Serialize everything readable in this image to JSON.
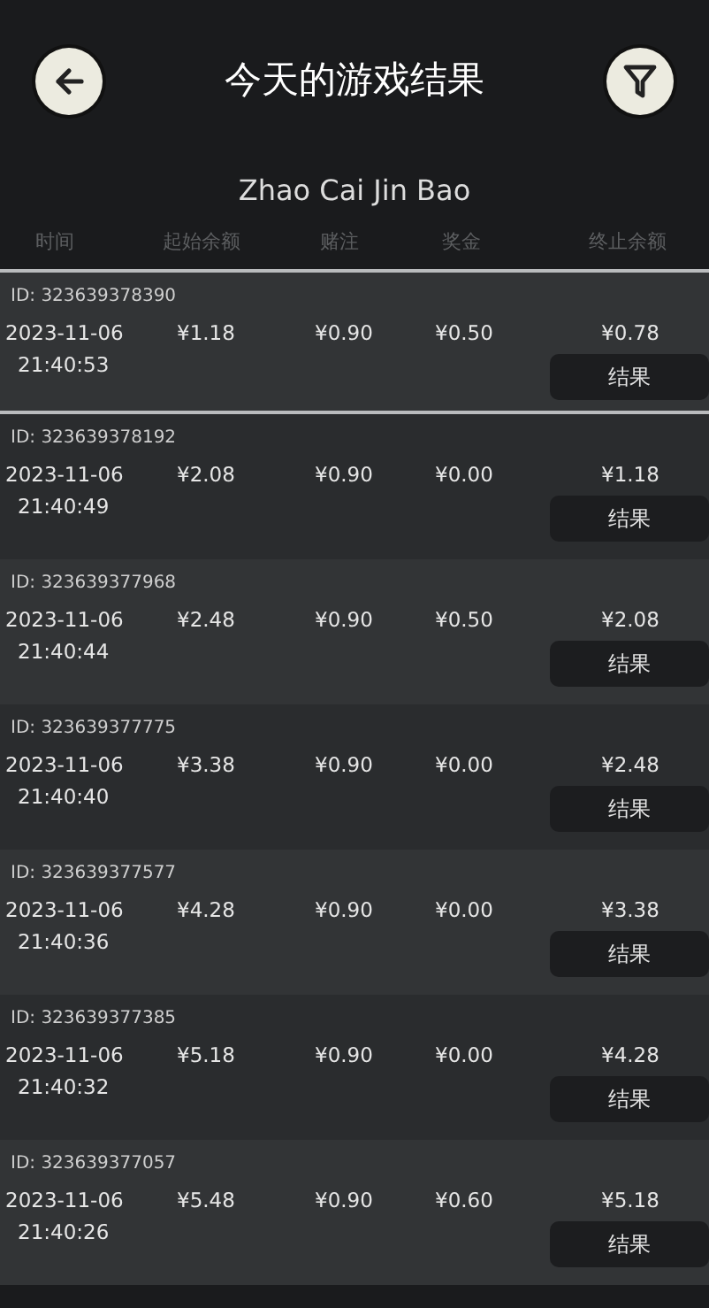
{
  "header": {
    "title": "今天的游戏结果"
  },
  "game_name": "Zhao Cai Jin Bao",
  "columns": [
    "时间",
    "起始余额",
    "赌注",
    "奖金",
    "终止余额"
  ],
  "rows": [
    {
      "id_label": "ID:",
      "id": "323639378390",
      "date": "2023-11-06",
      "time": "21:40:53",
      "start": "¥1.18",
      "bet": "¥0.90",
      "win": "¥0.50",
      "end": "¥0.78",
      "button": "结果",
      "selected": true
    },
    {
      "id_label": "ID:",
      "id": "323639378192",
      "date": "2023-11-06",
      "time": "21:40:49",
      "start": "¥2.08",
      "bet": "¥0.90",
      "win": "¥0.00",
      "end": "¥1.18",
      "button": "结果",
      "selected": false
    },
    {
      "id_label": "ID:",
      "id": "323639377968",
      "date": "2023-11-06",
      "time": "21:40:44",
      "start": "¥2.48",
      "bet": "¥0.90",
      "win": "¥0.50",
      "end": "¥2.08",
      "button": "结果",
      "selected": false
    },
    {
      "id_label": "ID:",
      "id": "323639377775",
      "date": "2023-11-06",
      "time": "21:40:40",
      "start": "¥3.38",
      "bet": "¥0.90",
      "win": "¥0.00",
      "end": "¥2.48",
      "button": "结果",
      "selected": false
    },
    {
      "id_label": "ID:",
      "id": "323639377577",
      "date": "2023-11-06",
      "time": "21:40:36",
      "start": "¥4.28",
      "bet": "¥0.90",
      "win": "¥0.00",
      "end": "¥3.38",
      "button": "结果",
      "selected": false
    },
    {
      "id_label": "ID:",
      "id": "323639377385",
      "date": "2023-11-06",
      "time": "21:40:32",
      "start": "¥5.18",
      "bet": "¥0.90",
      "win": "¥0.00",
      "end": "¥4.28",
      "button": "结果",
      "selected": false
    },
    {
      "id_label": "ID:",
      "id": "323639377057",
      "date": "2023-11-06",
      "time": "21:40:26",
      "start": "¥5.48",
      "bet": "¥0.90",
      "win": "¥0.60",
      "end": "¥5.18",
      "button": "结果",
      "selected": false
    }
  ]
}
